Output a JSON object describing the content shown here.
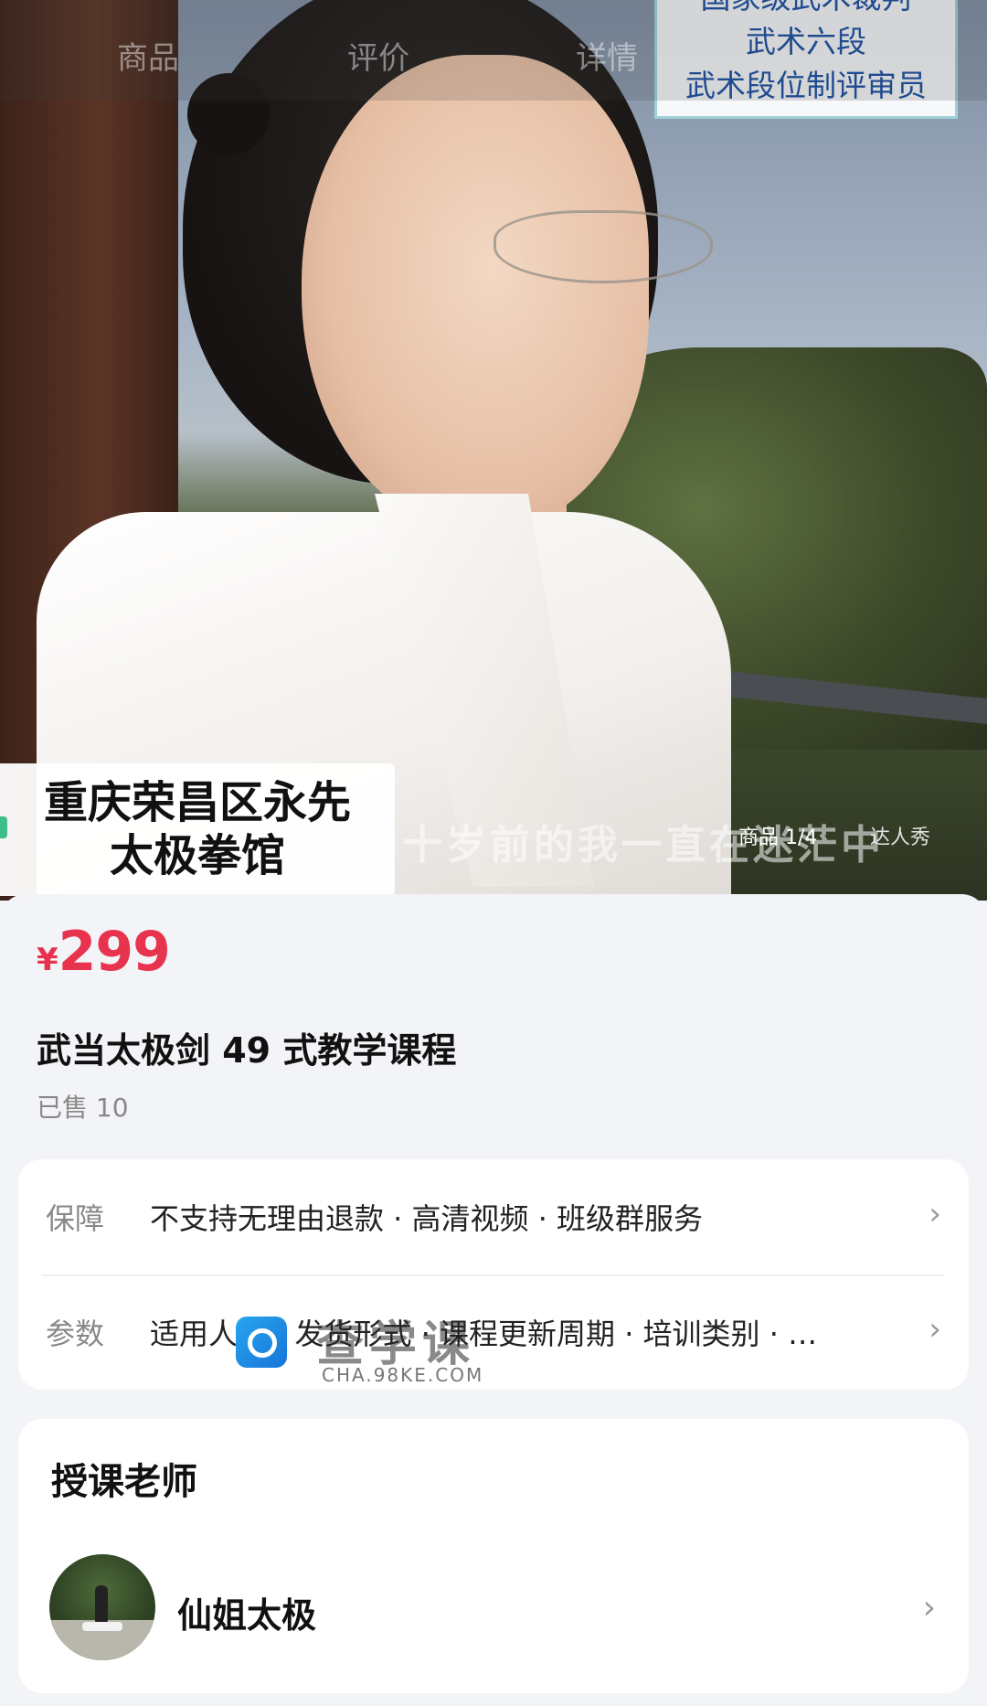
{
  "nav": {
    "tabs": [
      "商品",
      "评价",
      "详情"
    ]
  },
  "hero": {
    "credential_lines": [
      "国家级武术裁判",
      "武术六段",
      "武术段位制评审员"
    ],
    "hall_name_lines": [
      "重庆荣昌区永先",
      "太极拳馆"
    ],
    "burned_subtitle": "十岁前的我一直在迷茫中",
    "counter": "商品 1/4",
    "show_tab": "达人秀"
  },
  "product": {
    "currency": "¥",
    "price": "299",
    "title": "武当太极剑 49 式教学课程",
    "sold": "已售 10"
  },
  "guarantee": {
    "label": "保障",
    "value": "不支持无理由退款 · 高清视频 · 班级群服务"
  },
  "params": {
    "label": "参数",
    "value": "适用人群 · 发货形式 · 课程更新周期 · 培训类别 · …"
  },
  "watermark": {
    "text": "查学课",
    "url": "CHA.98KE.COM"
  },
  "teacher": {
    "heading": "授课老师",
    "name": "仙姐太极"
  },
  "colors": {
    "price": "#e8334e",
    "credential_text": "#1a4fa3",
    "hall_accent": "#3cbf8a",
    "background": "#f3f4f7"
  }
}
